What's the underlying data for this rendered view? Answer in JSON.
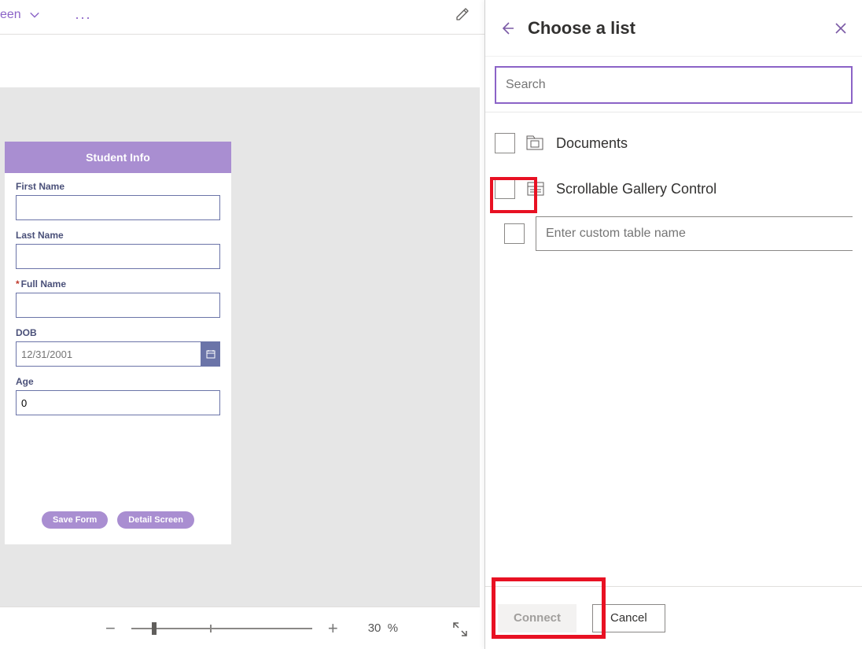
{
  "topbar": {
    "screen_label": "een",
    "more_glyph": "···"
  },
  "form": {
    "title": "Student Info",
    "fields": {
      "first_name_label": "First Name",
      "first_name_value": "",
      "last_name_label": "Last Name",
      "last_name_value": "",
      "full_name_label": "Full Name",
      "full_name_value": "",
      "dob_label": "DOB",
      "dob_placeholder": "12/31/2001",
      "age_label": "Age",
      "age_value": "0"
    },
    "buttons": {
      "save": "Save Form",
      "detail": "Detail Screen"
    }
  },
  "zoom": {
    "value": "30",
    "unit": "%"
  },
  "panel": {
    "title": "Choose a list",
    "search_placeholder": "Search",
    "items": [
      {
        "icon": "doclib",
        "label": "Documents"
      },
      {
        "icon": "list",
        "label": "Scrollable Gallery Control"
      }
    ],
    "custom_placeholder": "Enter custom table name",
    "connect_label": "Connect",
    "cancel_label": "Cancel"
  }
}
